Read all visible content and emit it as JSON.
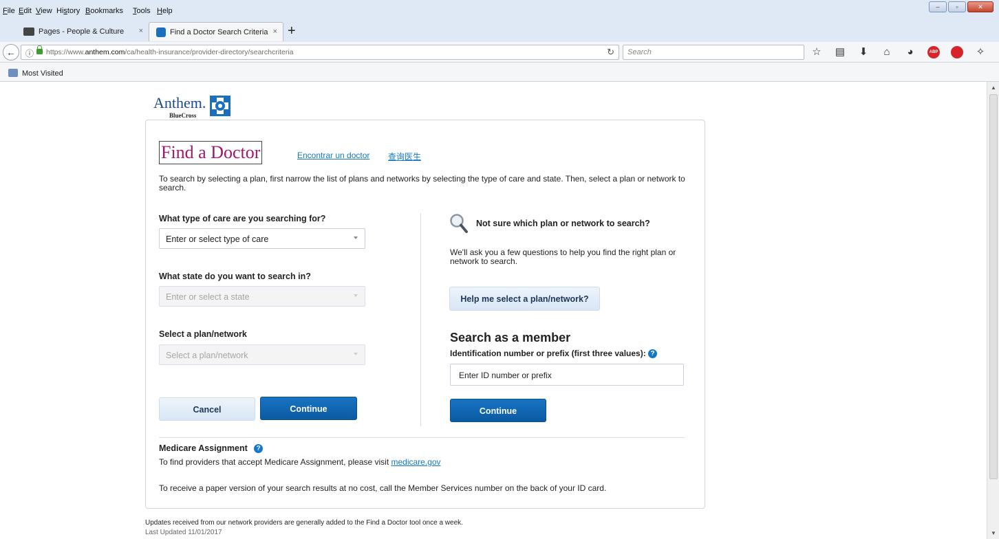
{
  "browser": {
    "menu": [
      {
        "u": "F",
        "rest": "ile"
      },
      {
        "u": "E",
        "rest": "dit"
      },
      {
        "u": "V",
        "rest": "iew"
      },
      {
        "pre": "Hi",
        "u": "s",
        "rest": "tory"
      },
      {
        "u": "B",
        "rest": "ookmarks"
      },
      {
        "u": "T",
        "rest": "ools"
      },
      {
        "u": "H",
        "rest": "elp"
      }
    ],
    "tabs": [
      {
        "label": "Pages - People & Culture",
        "close": "×"
      },
      {
        "label": "Find a Doctor Search Criteria",
        "close": "×"
      }
    ],
    "new_tab": "+",
    "url_prefix": "https://www.",
    "url_domain": "anthem.com",
    "url_path": "/ca/health-insurance/provider-directory/searchcriteria",
    "search_placeholder": "Search",
    "bookmarks": [
      {
        "label": "Most Visited"
      }
    ],
    "window_buttons": [
      "–",
      "▫",
      "✕"
    ],
    "colors": {
      "chrome": "#dfe9f5",
      "toolbar": "#f5f6f7"
    }
  },
  "logo": {
    "brand": "Anthem.",
    "sub": "BlueCross"
  },
  "page": {
    "title": "Find a Doctor",
    "lang_links": [
      "Encontrar un doctor",
      "查询医生"
    ],
    "intro": "To search by selecting a plan, first narrow the list of plans and networks by selecting the type of care and state. Then, select a plan or network to search.",
    "care_label": "What type of care are you searching for?",
    "care_placeholder": "Enter or select type of care",
    "state_label": "What state do you want to search in?",
    "state_placeholder": "Enter or select a state",
    "plan_label": "Select a plan/network",
    "plan_placeholder": "Select a plan/network",
    "cancel": "Cancel",
    "continue": "Continue",
    "right_head": "Not sure which plan or network to search?",
    "right_text": "We'll ask you a few questions to help you find the right plan or network to search.",
    "help_button": "Help me select a plan/network?",
    "member_title": "Search as a member",
    "member_label": "Identification number or prefix (first three values):",
    "member_placeholder": "Enter ID number or prefix",
    "member_continue": "Continue",
    "medicare_title": "Medicare Assignment",
    "medicare_text": "To find providers that accept Medicare Assignment, please visit ",
    "medicare_link": "medicare.gov",
    "paper_text": "To receive a paper version of your search results at no cost, call the Member Services number on the back of your ID card.",
    "footer_note": "Updates received from our network providers are generally added to the Find a Doctor tool once a week.",
    "footer_date": "Last Updated 11/01/2017",
    "help_icon": "?",
    "colors": {
      "title": "#a1176d",
      "link": "#1478c8",
      "primary": "#0b5aa2"
    }
  }
}
